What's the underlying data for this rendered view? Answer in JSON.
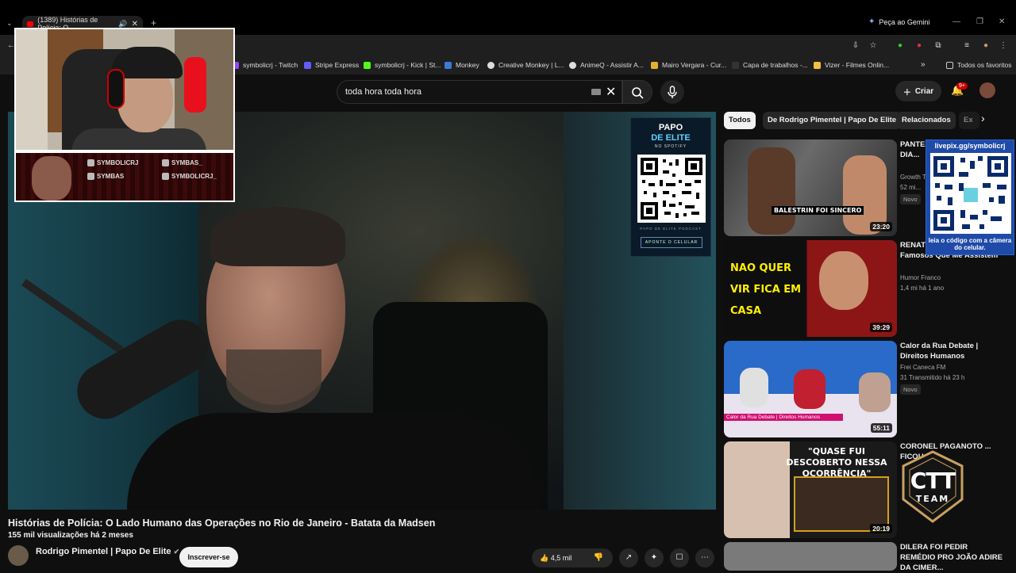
{
  "browser": {
    "tab_title": "(1389) Histórias de Polícia: O",
    "gemini": "Peça ao Gemini",
    "bookmarks": [
      "symbolicrj - Twitch",
      "Stripe Express",
      "symbolicrj - Kick | St...",
      "Monkey",
      "Creative Monkey | L...",
      "AnimeQ - Assistir A...",
      "Mairo Vergara - Cur...",
      "Capa de trabalhos -...",
      "Vizer - Filmes Onlin..."
    ],
    "favorites": "Todos os favoritos"
  },
  "youtube": {
    "search_query": "toda hora toda hora",
    "create_label": "Criar",
    "notif_badge": "9+"
  },
  "video": {
    "title": "Histórias de Polícia: O Lado Humano das Operações no Rio de Janeiro - Batata da Madsen",
    "meta": "155 mil visualizações  há 2 meses",
    "channel": "Rodrigo Pimentel | Papo De Elite",
    "subscribe": "Inscrever-se",
    "likes": "4,5 mil",
    "qr_card": {
      "line1": "PAPO",
      "line2": "DE ELITE",
      "line3": "NO SPOTIFY",
      "line4": "PAPO DE ELITE PODCAST",
      "button": "APONTE O CELULAR"
    }
  },
  "overlay": {
    "social": [
      "SYMBOLICRJ",
      "SYMBAS_",
      "SYMBAS",
      "SYMBOLICRJ_"
    ],
    "livepix_title": "livepix.gg/symbolicrj",
    "livepix_caption": "leia o código com a câmera do celular.",
    "ctt": "CTT TEAM"
  },
  "chips": [
    "Todos",
    "De Rodrigo Pimentel | Papo De Elite",
    "Relacionados",
    "Ex"
  ],
  "recommendations": [
    {
      "title": "PANTEI... BALEST... A 4 DIA...",
      "channel": "Growth T...",
      "meta": "52 mi...",
      "badge": "Novo",
      "duration": "23:20",
      "thumb_text": "BALESTRIN FOI SINCERO"
    },
    {
      "title": "RENATO... Sem Querer | Famosos Que Me Assistem",
      "channel": "Humor Franco",
      "meta": "1,4 mi  há 1 ano",
      "badge": "",
      "duration": "39:29",
      "thumb_text": "NAO QUER VIR FICA EM CASA"
    },
    {
      "title": "Calor da Rua Debate | Direitos Humanos",
      "channel": "Frei Caneca FM",
      "meta": "31  Transmitido há 23 h",
      "badge": "Novo",
      "duration": "55:11",
      "thumb_text": "Calor da Rua Debate | Direitos Humanos"
    },
    {
      "title": "CORONEL PAGANOTO ... FICOU ... C",
      "channel": "",
      "meta": "",
      "badge": "",
      "duration": "20:19",
      "thumb_text": "\"QUASE FUI DESCOBERTO NESSA OCORRÊNCIA\""
    },
    {
      "title": "DILERA FOI PEDIR REMÉDIO PRO JOÃO ADIRE DA CIMER...",
      "channel": "",
      "meta": "",
      "badge": "",
      "duration": "",
      "thumb_text": ""
    }
  ]
}
